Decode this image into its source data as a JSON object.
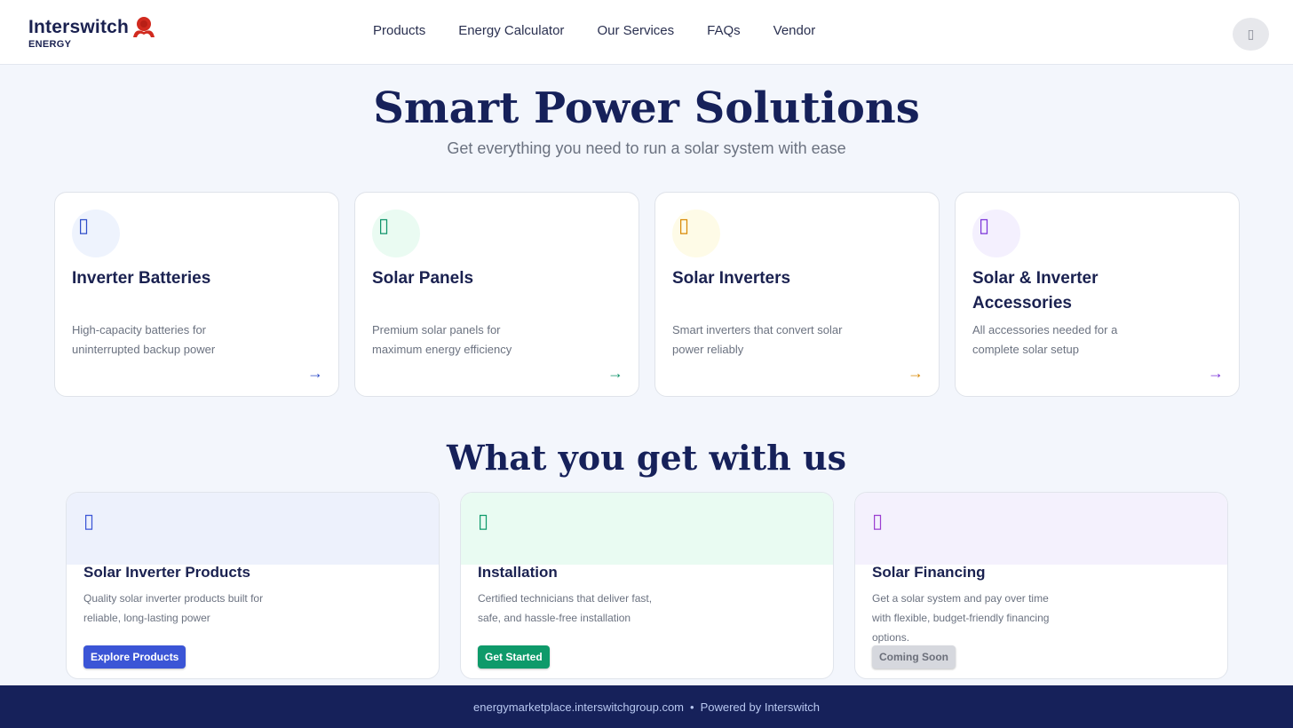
{
  "brand": {
    "name": "Interswitch",
    "sub": "ENERGY",
    "logo_color": "#d12a1f"
  },
  "nav": [
    "Products",
    "Energy Calculator",
    "Our Services",
    "FAQs",
    "Vendor"
  ],
  "header": {
    "user_icon": "user-icon"
  },
  "hero": {
    "title": "Smart Power Solutions",
    "subtitle": "Get everything you need to run a solar system with ease"
  },
  "categories": [
    {
      "title": "Inverter Batteries",
      "desc": "High-capacity batteries for uninterrupted backup power",
      "icon": "battery-icon",
      "accent": "#2f4ec9",
      "bg": "#eef3fd",
      "arrow": "→"
    },
    {
      "title": "Solar Panels",
      "desc": "Premium solar panels for maximum energy efficiency",
      "icon": "solar-panel-icon",
      "accent": "#11946b",
      "bg": "#eafbf2",
      "arrow": "→"
    },
    {
      "title": "Solar Inverters",
      "desc": "Smart inverters that convert solar power reliably",
      "icon": "inverter-icon",
      "accent": "#d98a07",
      "bg": "#fefbe7",
      "arrow": "→"
    },
    {
      "title": "Solar & Inverter Accessories",
      "desc": "All accessories needed for a complete solar setup",
      "icon": "plug-icon",
      "accent": "#7b34d8",
      "bg": "#f4f0fe",
      "arrow": "→"
    }
  ],
  "section_title": "What you get with us",
  "services": [
    {
      "title": "Solar Inverter Products",
      "desc": "Quality solar inverter products built for reliable, long-lasting power",
      "button": "Explore Products",
      "icon": "box-icon",
      "accent": "#3b55d6",
      "band": "#edf1fc",
      "btn_color": "#3b55d6"
    },
    {
      "title": "Installation",
      "desc": "Certified technicians that deliver fast, safe, and hassle-free installation",
      "button": "Get Started",
      "icon": "tools-icon",
      "accent": "#0e9a6a",
      "band": "#e9fbf2",
      "btn_color": "#0e9a6a"
    },
    {
      "title": "Solar Financing",
      "desc": "Get a solar system and pay over time with flexible, budget-friendly financing options.",
      "button": "Coming Soon",
      "icon": "wallet-icon",
      "accent": "#9b3fd1",
      "band": "#f4f1fd",
      "btn_color": "#d6d8de"
    }
  ],
  "footer": {
    "domain": "energymarketplace.interswitchgroup.com",
    "separator": "•",
    "powered": "Powered by Interswitch"
  }
}
